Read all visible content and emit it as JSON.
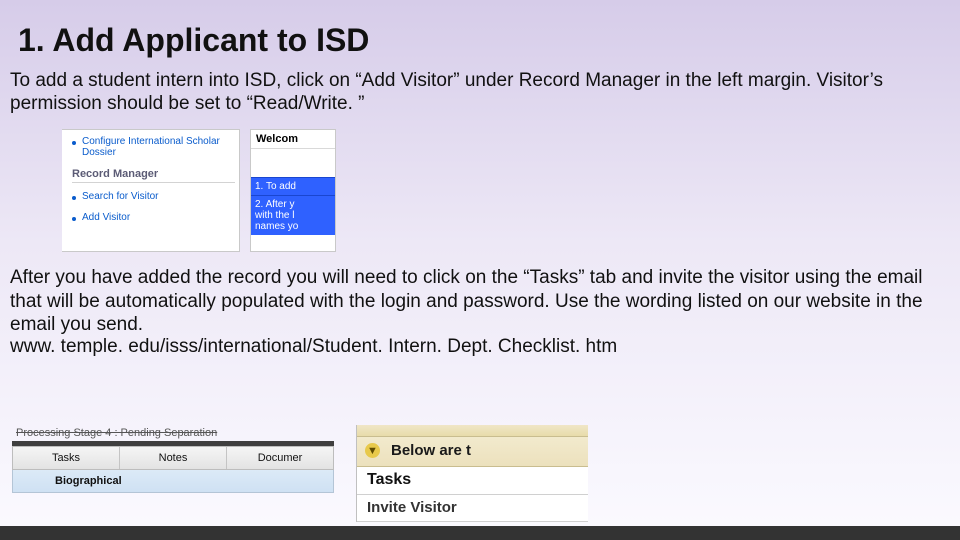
{
  "title": "1. Add Applicant to ISD",
  "para1": "To add a student intern into ISD, click on “Add Visitor” under Record Manager in the left margin. Visitor’s permission should be set to “Read/Write. ”",
  "para2": "After you have added the record you will need to click on the “Tasks” tab and invite the visitor using the email that will be automatically populated with the login and password. Use the wording listed on our website in the email you send.",
  "url": "www. temple. edu/isss/international/Student. Intern. Dept. Checklist. htm",
  "shot1": {
    "sidebar": {
      "link_configure": "Configure International Scholar Dossier",
      "section_head": "Record Manager",
      "link_search": "Search for Visitor",
      "link_add": "Add Visitor"
    },
    "content": {
      "welcome": "Welcom",
      "step1": "1. To add",
      "step2": "2. After y\nwith the l\nnames yo"
    }
  },
  "shot2": {
    "left": {
      "psline": "Processing Stage 4 : Pending Separation",
      "tabs": {
        "tasks": "Tasks",
        "notes": "Notes",
        "docs": "Documer"
      },
      "subhead": "Biographical"
    },
    "right": {
      "below": "Below are t",
      "taskhead": "Tasks",
      "invite": "Invite Visitor"
    }
  }
}
